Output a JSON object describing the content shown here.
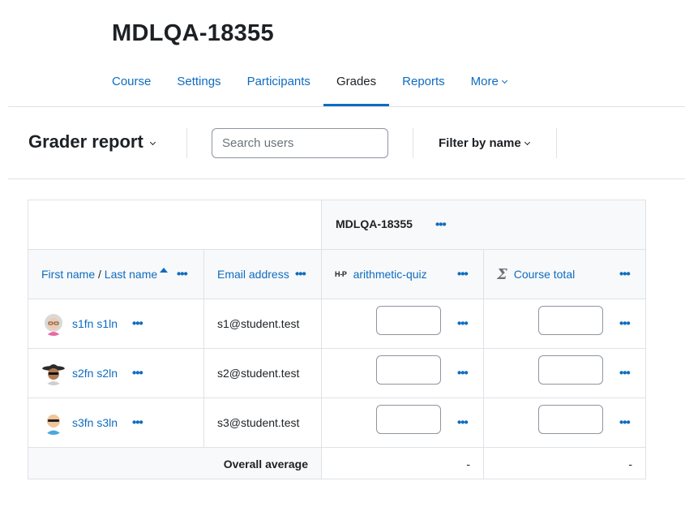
{
  "course": {
    "title": "MDLQA-18355"
  },
  "nav": {
    "items": [
      {
        "label": "Course"
      },
      {
        "label": "Settings"
      },
      {
        "label": "Participants"
      },
      {
        "label": "Grades",
        "active": true
      },
      {
        "label": "Reports"
      },
      {
        "label": "More"
      }
    ]
  },
  "report": {
    "title": "Grader report",
    "search_placeholder": "Search users",
    "filter_label": "Filter by name"
  },
  "table": {
    "category_header": "MDLQA-18355",
    "columns": {
      "name_first": "First name",
      "name_sep": " / ",
      "name_last": "Last name",
      "email": "Email address",
      "activity_icon": "H-P",
      "activity": "arithmetic-quiz",
      "total": "Course total"
    },
    "rows": [
      {
        "name": "s1fn s1ln",
        "email": "s1@student.test",
        "avatar": "avatar-grey-hair-glasses",
        "grade": "",
        "total": ""
      },
      {
        "name": "s2fn s2ln",
        "email": "s2@student.test",
        "avatar": "avatar-black-hat-sunglasses",
        "grade": "",
        "total": ""
      },
      {
        "name": "s3fn s3ln",
        "email": "s3@student.test",
        "avatar": "avatar-bald-sunglasses",
        "grade": "",
        "total": ""
      }
    ],
    "average": {
      "label": "Overall average",
      "activity": "-",
      "total": "-"
    }
  },
  "colors": {
    "link": "#0f6cbf",
    "text": "#1d2125",
    "border": "#dee2e6",
    "header_bg": "#f8f9fa"
  }
}
